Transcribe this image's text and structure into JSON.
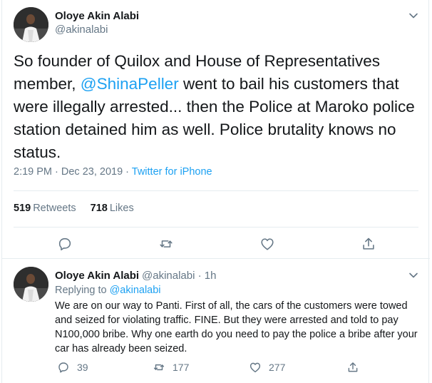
{
  "main_tweet": {
    "author_name": "Oloye Akin Alabi",
    "author_handle": "@akinalabi",
    "text_before": "So founder of Quilox and House of Representatives member, ",
    "mention": "@ShinaPeller",
    "text_after": " went to bail his customers that were illegally arrested... then the Police at Maroko police station detained him as well. Police brutality knows no status.",
    "timestamp": "2:19 PM · Dec 23, 2019",
    "separator": " · ",
    "source": "Twitter for iPhone",
    "retweets_count": "519",
    "retweets_label": "Retweets",
    "likes_count": "718",
    "likes_label": "Likes"
  },
  "reply_tweet": {
    "author_name": "Oloye Akin Alabi",
    "author_handle": "@akinalabi · 1h",
    "replying_label": "Replying to ",
    "replying_to": "@akinalabi",
    "text": "We are on our way to Panti. First of all, the cars of the customers were towed and seized for violating traffic. FINE. But they were arrested and told to pay N100,000 bribe. Why one earth do you need to pay the police a bribe after your car has already been seized.",
    "replies_count": "39",
    "retweets_count": "177",
    "likes_count": "277"
  },
  "colors": {
    "accent": "#1da1f2",
    "secondary_text": "#657786",
    "divider": "#e6ecf0"
  },
  "icons": [
    "chevron-down-icon",
    "reply-icon",
    "retweet-icon",
    "like-icon",
    "share-icon"
  ]
}
